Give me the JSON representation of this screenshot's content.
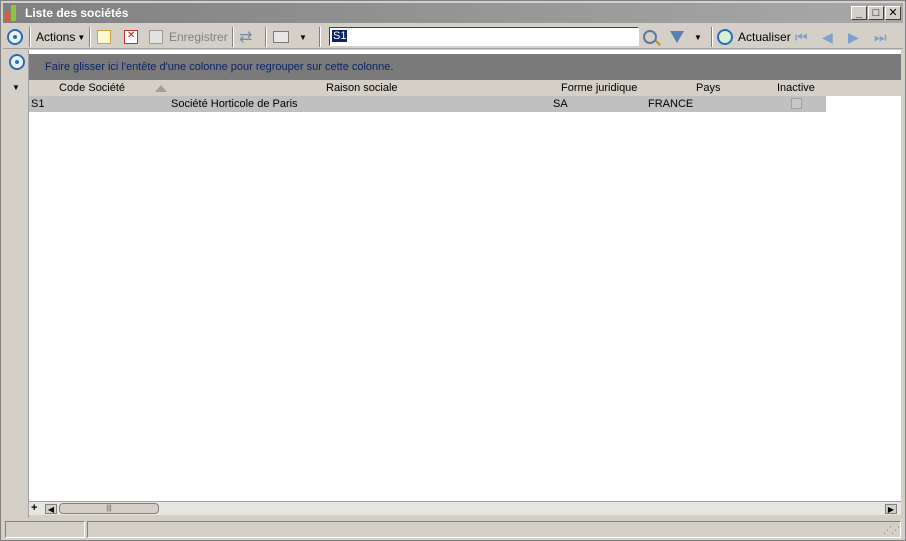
{
  "window": {
    "title": "Liste des sociétés"
  },
  "toolbar": {
    "actions_label": "Actions",
    "save_label": "Enregistrer",
    "search_value": "S1",
    "refresh_label": "Actualiser"
  },
  "grid": {
    "group_hint": "Faire glisser ici l'entête d'une colonne pour regrouper sur cette colonne.",
    "columns": [
      "Code Société",
      "Raison sociale",
      "Forme juridique",
      "Pays",
      "Inactive"
    ],
    "rows": [
      {
        "code": "S1",
        "raison": "Société Horticole de Paris",
        "forme": "SA",
        "pays": "FRANCE",
        "inactive": false
      }
    ]
  },
  "colors": {
    "selection": "#0a246a",
    "title_bar": "#808080",
    "group_panel": "#7a7a7a",
    "row_selected": "#c0c0c0"
  }
}
